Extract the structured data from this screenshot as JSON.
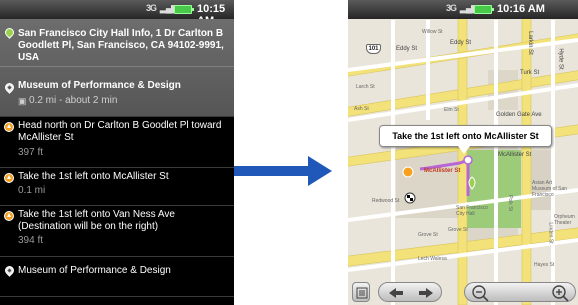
{
  "left_screen": {
    "status": {
      "network": "3G",
      "time": "10:15 AM"
    },
    "start": {
      "address": "San Francisco City Hall Info, 1 Dr Carlton B Goodlett Pl, San Francisco, CA 94102-9991, USA"
    },
    "destination": {
      "name": "Museum of Performance & Design",
      "summary": "0.2 mi - about 2 min"
    },
    "steps": [
      {
        "text": "Head north on Dr Carlton B Goodlet Pl toward McAllister St",
        "distance": "397 ft"
      },
      {
        "text": "Take the 1st left onto McAllister St",
        "distance": "0.1 mi"
      },
      {
        "text": "Take the 1st left onto Van Ness Ave (Destination will be on the right)",
        "distance": "394 ft"
      },
      {
        "text": "Museum of Performance & Design",
        "distance": ""
      }
    ]
  },
  "right_screen": {
    "status": {
      "network": "3G",
      "time": "10:16 AM"
    },
    "callout": "Take the 1st left onto McAllister St",
    "route_color": "#b866d6",
    "map_labels": {
      "street_1": "Willow St",
      "street_2": "Eddy St",
      "street_3": "Eddy St",
      "street_4": "Larkin St",
      "street_5": "Hyde St",
      "street_6": "Turk St",
      "street_7": "Larch St",
      "street_8": "Elm St",
      "street_9": "Golden Gate Ave",
      "street_10": "McAllister St",
      "street_11": "McAllister St",
      "street_12": "Grove St",
      "street_13": "Grove St",
      "street_14": "Hayes St",
      "street_15": "Linden St",
      "street_16": "Lech Walesa",
      "street_17": "Polk St",
      "street_18": "Redwood St",
      "street_19": "Ash St",
      "poi_1": "Asian Art Museum of San Francisco",
      "poi_2": "San Francisco City Hall",
      "poi_3": "Orpheum Theater",
      "route_shield": "101"
    },
    "controls": [
      "menu-icon",
      "previous-icon",
      "next-icon",
      "zoom-out-icon",
      "zoom-in-icon"
    ]
  }
}
